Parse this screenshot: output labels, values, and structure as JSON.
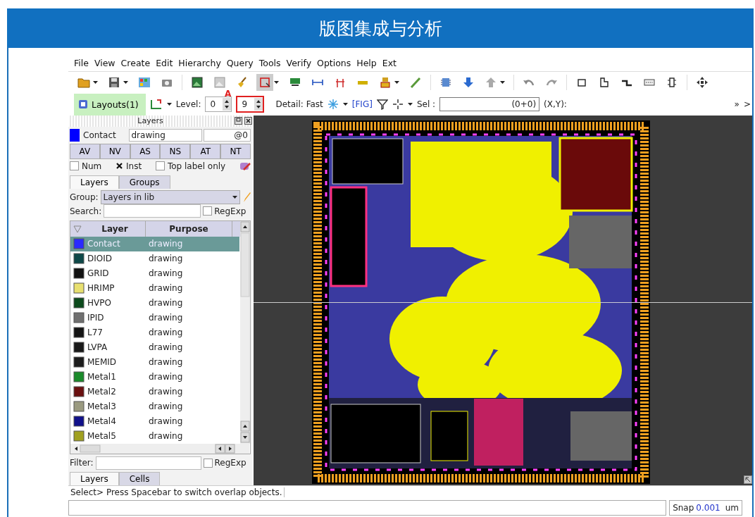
{
  "banner": {
    "title": "版图集成与分析"
  },
  "menu": [
    {
      "label": "File"
    },
    {
      "label": "View"
    },
    {
      "label": "Create"
    },
    {
      "label": "Edit"
    },
    {
      "label": "Hierarchy"
    },
    {
      "label": "Query"
    },
    {
      "label": "Tools"
    },
    {
      "label": "Verify"
    },
    {
      "label": "Options"
    },
    {
      "label": "Help"
    },
    {
      "label": "Ext"
    }
  ],
  "toolbar2": {
    "layouts": "Layouts(1)",
    "level_label": "Level:",
    "level_from": "0",
    "level_to": "9",
    "marker": "A",
    "detail": "Detail: Fast",
    "fig": "[FIG]",
    "sel_label": "Sel :",
    "sel_value": "(0+0)",
    "xy_label": "(X,Y):",
    "overflow": "»",
    "more": ">"
  },
  "layers_panel": {
    "title": "Layers",
    "current": {
      "layer": "Contact",
      "purpose": "drawing",
      "index": "@0",
      "color": "#0000ff"
    },
    "buttons": [
      "AV",
      "NV",
      "AS",
      "NS",
      "AT",
      "NT"
    ],
    "checks": [
      {
        "label": "Num",
        "checked": false
      },
      {
        "label": "Inst",
        "checked": true
      },
      {
        "label": "Top label only",
        "checked": false
      }
    ],
    "tabs": [
      {
        "label": "Layers",
        "selected": true
      },
      {
        "label": "Groups",
        "selected": false
      }
    ],
    "group_label": "Group:",
    "group_value": "Layers in lib",
    "search_label": "Search:",
    "search_regexp": {
      "label": "RegExp",
      "checked": false
    },
    "columns": [
      "Layer",
      "Purpose"
    ],
    "rows": [
      {
        "name": "Contact",
        "purpose": "drawing",
        "color": "#2a2aff",
        "selected": true
      },
      {
        "name": "DIOID",
        "purpose": "drawing",
        "color": "#0e4848",
        "selected": false
      },
      {
        "name": "GRID",
        "purpose": "drawing",
        "color": "#111111",
        "selected": false
      },
      {
        "name": "HRIMP",
        "purpose": "drawing",
        "color": "#e8e070",
        "selected": false
      },
      {
        "name": "HVPO",
        "purpose": "drawing",
        "color": "#0c4a1c",
        "selected": false
      },
      {
        "name": "IPID",
        "purpose": "drawing",
        "color": "#707070",
        "selected": false
      },
      {
        "name": "L77",
        "purpose": "drawing",
        "color": "#141414",
        "selected": false
      },
      {
        "name": "LVPA",
        "purpose": "drawing",
        "color": "#181818",
        "selected": false
      },
      {
        "name": "MEMID",
        "purpose": "drawing",
        "color": "#1c1c1c",
        "selected": false
      },
      {
        "name": "Metal1",
        "purpose": "drawing",
        "color": "#1a8a2a",
        "selected": false
      },
      {
        "name": "Metal2",
        "purpose": "drawing",
        "color": "#6a1010",
        "selected": false
      },
      {
        "name": "Metal3",
        "purpose": "drawing",
        "color": "#9a9a80",
        "selected": false
      },
      {
        "name": "Metal4",
        "purpose": "drawing",
        "color": "#10108a",
        "selected": false
      },
      {
        "name": "Metal5",
        "purpose": "drawing",
        "color": "#a0a020",
        "selected": false
      }
    ],
    "filter_label": "Filter:",
    "filter_regexp": {
      "label": "RegExp",
      "checked": false
    },
    "bottom_tabs": [
      {
        "label": "Layers",
        "selected": true
      },
      {
        "label": "Cells",
        "selected": false
      }
    ]
  },
  "status": {
    "message": "Select> Press Spacebar to switch overlap objects.",
    "snap_label": "Snap",
    "snap_value": "0.001",
    "snap_unit": "um"
  }
}
